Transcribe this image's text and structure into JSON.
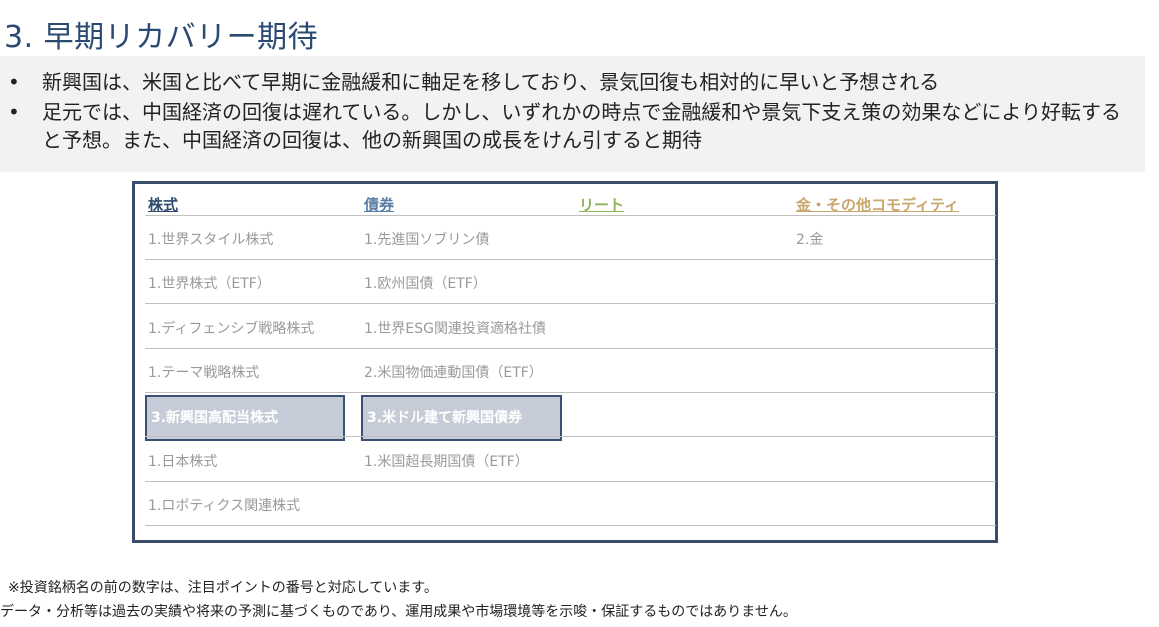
{
  "title": "3. 早期リカバリー期待",
  "bullets": [
    "新興国は、米国と比べて早期に金融緩和に軸足を移しており、景気回復も相対的に早いと予想される",
    "足元では、中国経済の回復は遅れている。しかし、いずれかの時点で金融緩和や景気下支え策の効果などにより好転すると予想。また、中国経済の回復は、他の新興国の成長をけん引すると期待"
  ],
  "bullet_marker": "•",
  "table": {
    "headers": [
      {
        "label": "株式",
        "color": "#2f4a6e"
      },
      {
        "label": "債券",
        "color": "#5b80a6"
      },
      {
        "label": "リート",
        "color": "#8fb358"
      },
      {
        "label": "金・その他コモディティ",
        "color": "#c9a66b"
      }
    ],
    "rows": [
      [
        "1.世界スタイル株式",
        "1.先進国ソブリン債",
        "",
        "2.金"
      ],
      [
        "1.世界株式（ETF）",
        "1.欧州国債（ETF）",
        "",
        ""
      ],
      [
        "1.ディフェンシブ戦略株式",
        "1.世界ESG関連投資適格社債",
        "",
        ""
      ],
      [
        "1.テーマ戦略株式",
        "2.米国物価連動国債（ETF）",
        "",
        ""
      ],
      [
        "3.新興国高配当株式",
        "3.米ドル建て新興国債券",
        "",
        ""
      ],
      [
        "1.日本株式",
        "1.米国超長期国債（ETF）",
        "",
        ""
      ],
      [
        "1.ロボティクス関連株式",
        "",
        "",
        ""
      ]
    ],
    "highlighted_row_index": 4
  },
  "notes": [
    "※投資銘柄名の前の数字は、注目ポイントの番号と対応しています。",
    "データ・分析等は過去の実績や将来の予測に基づくものであり、運用成果や市場環境等を示唆・保証するものではありません。"
  ]
}
